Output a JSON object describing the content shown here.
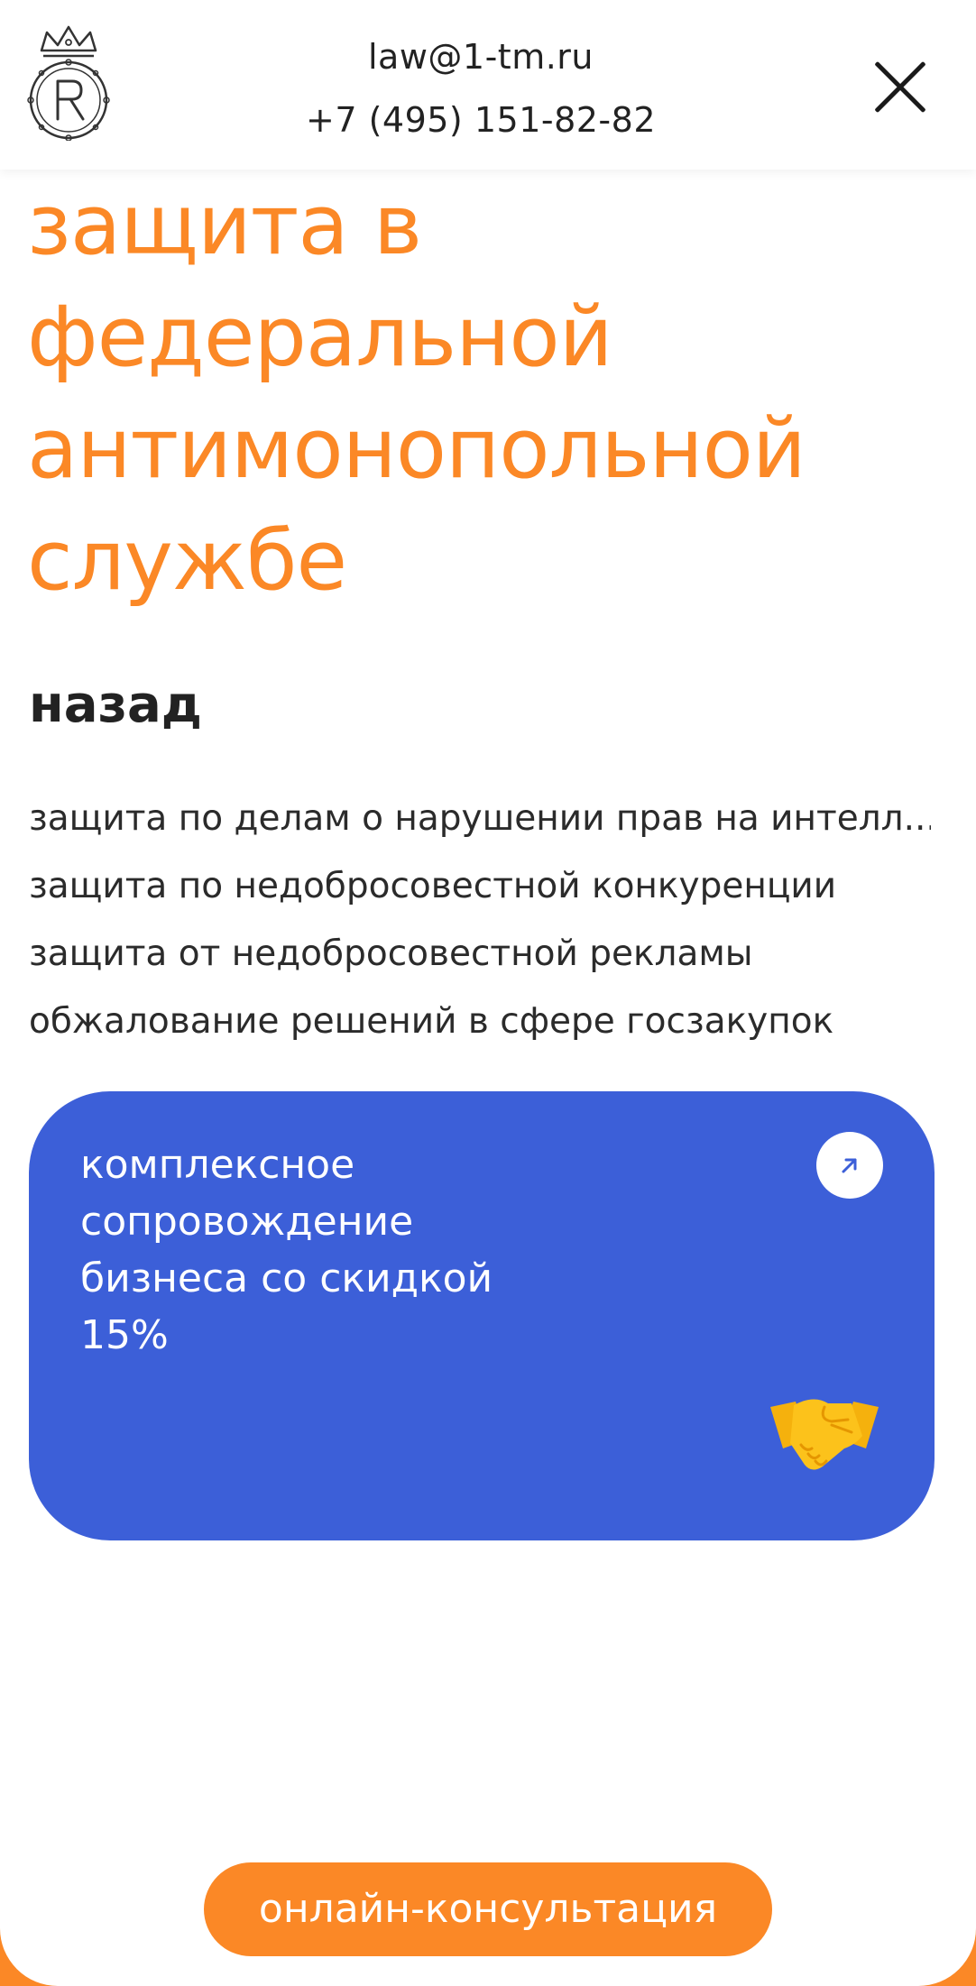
{
  "header": {
    "email": "law@1-tm.ru",
    "phone": "+7 (495) 151-82-82"
  },
  "main": {
    "heading_lines": [
      "защита в",
      "федеральной",
      "антимонопольной",
      "службе"
    ],
    "back_label": "назад",
    "menu_items": [
      "защита по делам о нарушении прав на интелл...",
      "защита по недобросовестной конкуренции",
      "защита от недобросовестной рекламы",
      "обжалование решений в сфере госзакупок"
    ]
  },
  "promo": {
    "lines": [
      "комплексное",
      "сопровождение",
      "бизнеса со скидкой",
      "15%"
    ],
    "arrow_icon": "arrow-up-right-icon",
    "emoji_icon": "handshake-icon"
  },
  "cta": {
    "label": "онлайн-консультация"
  },
  "colors": {
    "accent_orange": "#fb8826",
    "card_blue": "#3c5fd8",
    "text_dark": "#222222"
  }
}
